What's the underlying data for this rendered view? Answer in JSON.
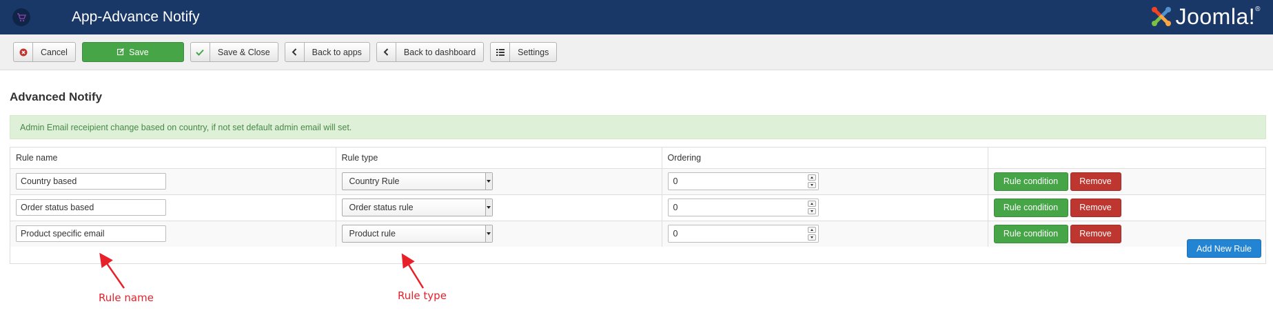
{
  "header": {
    "title": "App-Advance Notify",
    "app_icon": "cart-icon",
    "brand": "Joomla!",
    "brand_mark": "®",
    "brand_color": "#1a3867"
  },
  "toolbar": {
    "cancel": "Cancel",
    "save": "Save",
    "save_close": "Save & Close",
    "back_apps": "Back to apps",
    "back_dashboard": "Back to dashboard",
    "settings": "Settings"
  },
  "page": {
    "title": "Advanced Notify",
    "alert": "Admin Email receipient change based on country, if not set default admin email will set."
  },
  "table": {
    "headers": [
      "Rule name",
      "Rule type",
      "Ordering",
      ""
    ],
    "rows": [
      {
        "name": "Country based",
        "type": "Country Rule",
        "ordering": "0",
        "condition": "Rule condition",
        "remove": "Remove"
      },
      {
        "name": "Order status based",
        "type": "Order status rule",
        "ordering": "0",
        "condition": "Rule condition",
        "remove": "Remove"
      },
      {
        "name": "Product specific email",
        "type": "Product rule",
        "ordering": "0",
        "condition": "Rule condition",
        "remove": "Remove"
      }
    ],
    "add_button": "Add New Rule"
  },
  "annotations": {
    "rule_name": "Rule name",
    "rule_type": "Rule type",
    "color": "#e8202a"
  }
}
